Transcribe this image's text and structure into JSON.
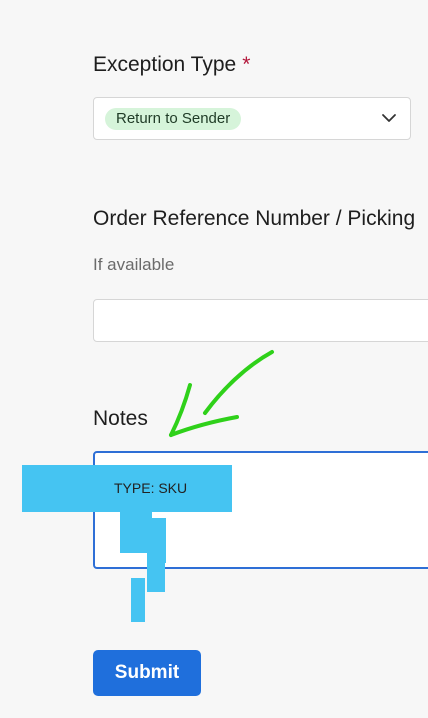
{
  "exception_type": {
    "label": "Exception Type",
    "required_marker": "*",
    "selected_value": "Return to Sender"
  },
  "order_reference": {
    "label": "Order Reference Number / Picking",
    "helper": "If available",
    "value": ""
  },
  "notes": {
    "label": "Notes",
    "value": "TYPE: SKU"
  },
  "submit": {
    "label": "Submit"
  },
  "colors": {
    "primary": "#1f6fdc",
    "focus_border": "#2e6fd6",
    "chip_bg": "#d6f4da",
    "required": "#b3173b",
    "annotation_arrow": "#2fd11a",
    "redaction": "#45c4f2"
  }
}
